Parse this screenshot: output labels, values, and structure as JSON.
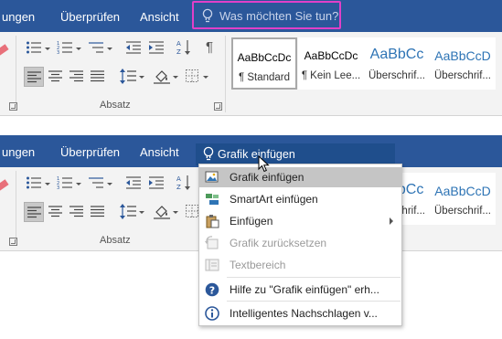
{
  "top": {
    "tabs": [
      "ungen",
      "Überprüfen",
      "Ansicht"
    ],
    "tellme_placeholder": "Was möchten Sie tun?",
    "group_absatz": "Absatz",
    "styles": [
      {
        "sample": "AaBbCcDc",
        "name": "¶ Standard"
      },
      {
        "sample": "AaBbCcDc",
        "name": "¶ Kein Lee..."
      },
      {
        "sample": "AaBbCc",
        "name": "Überschrif..."
      },
      {
        "sample": "AaBbCcD",
        "name": "Überschrif..."
      }
    ]
  },
  "bottom": {
    "tabs": [
      "ungen",
      "Überprüfen",
      "Ansicht"
    ],
    "tellme_value": "Grafik einfügen",
    "group_absatz": "Absatz",
    "styles": [
      {
        "sample": "AaBbCc",
        "name": "Überschrif..."
      },
      {
        "sample": "AaBbCcD",
        "name": "Überschrif..."
      }
    ],
    "menu": [
      {
        "label": "Grafik einfügen",
        "icon": "picture-icon",
        "state": "highlighted"
      },
      {
        "label": "SmartArt einfügen",
        "icon": "smartart-icon",
        "state": "enabled"
      },
      {
        "label": "Einfügen",
        "icon": "paste-icon",
        "state": "enabled",
        "submenu": true
      },
      {
        "label": "Grafik zurücksetzen",
        "icon": "reset-picture-icon",
        "state": "disabled"
      },
      {
        "label": "Textbereich",
        "icon": "text-pane-icon",
        "state": "disabled"
      },
      {
        "label": "Hilfe zu \"Grafik einfügen\" erh...",
        "icon": "help-icon",
        "state": "enabled"
      },
      {
        "label": "Intelligentes Nachschlagen v...",
        "icon": "info-icon",
        "state": "enabled"
      }
    ]
  },
  "colors": {
    "tab_bar": "#2b579a",
    "highlight_border": "#e040c8",
    "menu_highlight": "#c5c5c5",
    "heading_blue": "#2e74b5"
  }
}
